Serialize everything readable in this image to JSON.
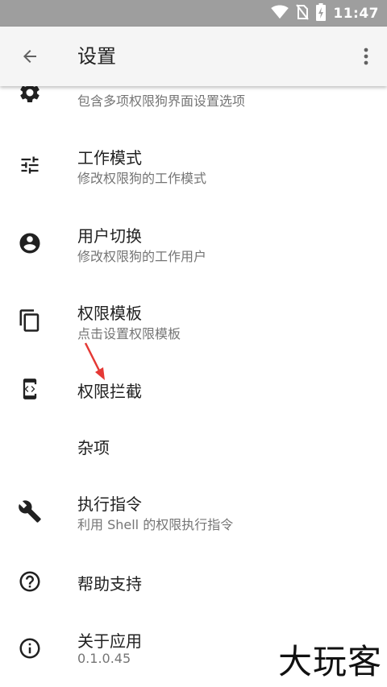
{
  "status_bar": {
    "time": "11:47"
  },
  "app_bar": {
    "title": "设置"
  },
  "items": [
    {
      "title": "",
      "subtitle": "包含多项权限狗界面设置选项",
      "icon": "settings-icon"
    },
    {
      "title": "工作模式",
      "subtitle": "修改权限狗的工作模式",
      "icon": "tune-sliders-icon"
    },
    {
      "title": "用户切换",
      "subtitle": "修改权限狗的工作用户",
      "icon": "account-circle-icon"
    },
    {
      "title": "权限模板",
      "subtitle": "点击设置权限模板",
      "icon": "copy-icon"
    },
    {
      "title": "权限拦截",
      "icon": "phone-code-icon"
    },
    {
      "title": "杂项"
    },
    {
      "title": "执行指令",
      "subtitle": "利用 Shell 的权限执行指令",
      "icon": "wrench-icon"
    },
    {
      "title": "帮助支持",
      "icon": "help-circle-icon"
    },
    {
      "title": "关于应用",
      "subtitle": "0.1.0.45",
      "icon": "info-icon"
    }
  ],
  "watermark": "大玩客",
  "colors": {
    "status_bar": "#9e9e9e",
    "app_bar": "#f5f5f5",
    "annotation_arrow": "#e53935"
  }
}
